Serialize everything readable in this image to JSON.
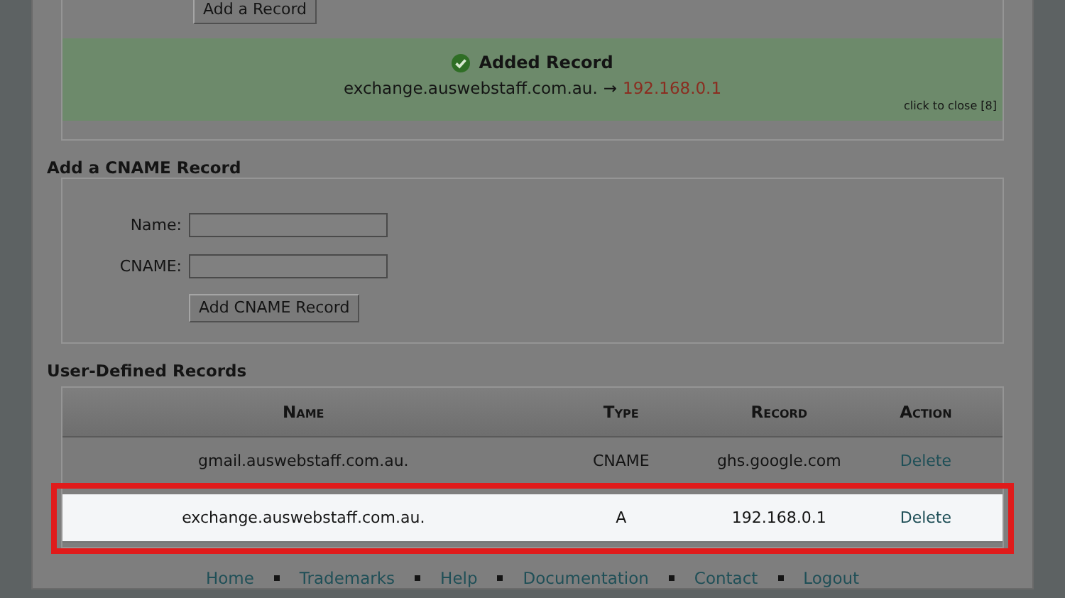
{
  "add_record_button": "Add a Record",
  "notice": {
    "title": "Added Record",
    "name": "exchange.auswebstaff.com.au.",
    "arrow": "→",
    "value": "192.168.0.1",
    "close": "click to close [8]"
  },
  "cname_form": {
    "title": "Add a CNAME Record",
    "fields": [
      {
        "label": "Name:"
      },
      {
        "label": "CNAME:"
      }
    ],
    "button": "Add CNAME Record"
  },
  "records": {
    "title": "User-Defined Records",
    "columns": [
      "Name",
      "Type",
      "Record",
      "Action"
    ],
    "rows": [
      {
        "name": "gmail.auswebstaff.com.au.",
        "type": "CNAME",
        "record": "ghs.google.com",
        "action": "Delete",
        "highlighted": false
      },
      {
        "name": "exchange.auswebstaff.com.au.",
        "type": "A",
        "record": "192.168.0.1",
        "action": "Delete",
        "highlighted": true
      }
    ]
  },
  "footer_links": [
    "Home",
    "Trademarks",
    "Help",
    "Documentation",
    "Contact",
    "Logout"
  ]
}
